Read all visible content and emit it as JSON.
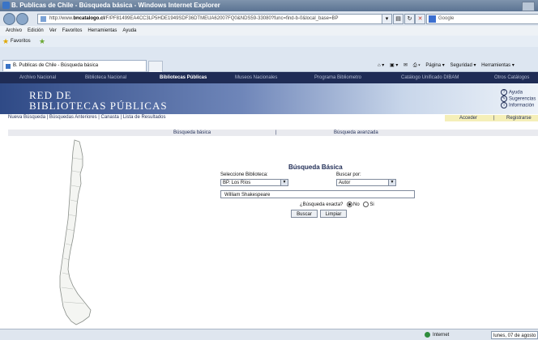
{
  "window": {
    "title": "B. Publicas de Chile - Búsqueda básica - Windows Internet Explorer"
  },
  "address": {
    "prefix": "http://www.",
    "domain": "bncatalogo.cl",
    "path": "/F/PF81499EA4CC3LP5HDE1949SDF36DTMEUA62007FQ0&NDS59-33080?func=find-b-0&local_base=BP"
  },
  "search_box": {
    "placeholder": "Google"
  },
  "menu": [
    "Archivo",
    "Edición",
    "Ver",
    "Favoritos",
    "Herramientas",
    "Ayuda"
  ],
  "favorites": {
    "label": "Favoritos"
  },
  "tab": {
    "label": "B. Publicas de Chile - Búsqueda básica"
  },
  "command_bar": {
    "page": "Página ▾",
    "safety": "Seguridad ▾",
    "tools": "Herramientas ▾"
  },
  "site_nav": [
    "Archivo Nacional",
    "Biblioteca Nacional",
    "Bibliotecas Públicas",
    "Museos Nacionales",
    "Programa Bibliometro",
    "Catálogo Unificado DIBAM",
    "Otros Catálogos"
  ],
  "banner": {
    "line1": "RED DE",
    "line2": "BIBLIOTECAS PÚBLICAS"
  },
  "help_links": [
    "Ayuda",
    "Sugerencias",
    "Información"
  ],
  "links_bar": "Nueva Búsqueda | Búsquedas Anteriores | Canasta | Lista de Resultados",
  "account": {
    "login": "Acceder",
    "separator": "|",
    "register": "Registrarse"
  },
  "modes": {
    "basic": "Búsqueda básica",
    "separator": "|",
    "advanced": "Búsqueda avanzada"
  },
  "form": {
    "title": "Búsqueda Básica",
    "library_label": "Seleccione Biblioteca:",
    "library_value": "BP. Los Ríos",
    "search_by_label": "Buscar por:",
    "search_by_value": "Autor",
    "query": "William Shakespeare",
    "exact_label": "¿Búsqueda exacta?",
    "no_label": "No",
    "yes_label": "Si",
    "exact_selected": "No",
    "search_button": "Buscar",
    "clear_button": "Limpiar"
  },
  "status": {
    "zone": "Internet",
    "date": "lunes, 07 de agosto"
  },
  "colors": {
    "nav_bg": "#1f2c55",
    "banner_dark": "#2f4a86",
    "accent_bar": "#f5efb8"
  }
}
